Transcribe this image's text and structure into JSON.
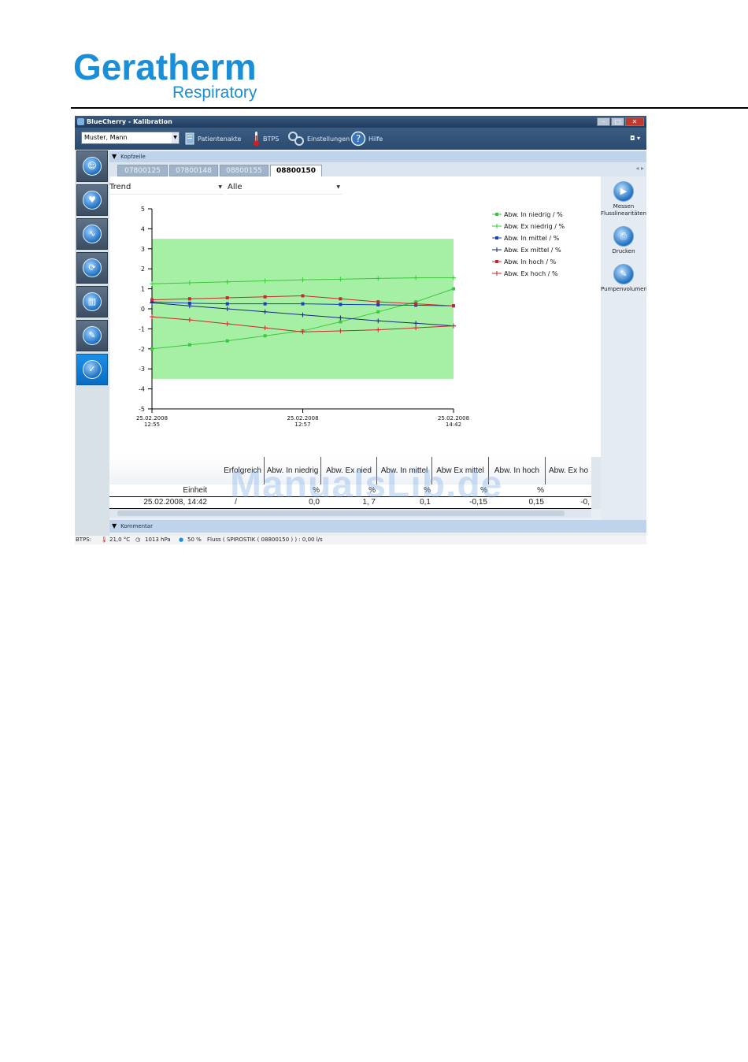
{
  "logo": {
    "brand": "Geratherm",
    "sub": "Respiratory"
  },
  "window": {
    "title": "BlueCherry - Kalibration",
    "controls": [
      "–",
      "□",
      "✕"
    ]
  },
  "toolbar": {
    "patient": "Muster, Mann",
    "patient_file": "Patientenakte",
    "btps": "BTPS",
    "settings": "Einstellungen",
    "help": "Hilfe"
  },
  "header_section": "Kopfzeile",
  "tabs": [
    {
      "label": "07800125"
    },
    {
      "label": "07800148"
    },
    {
      "label": "08800155"
    },
    {
      "label": "08800150",
      "active": true
    }
  ],
  "selectors": {
    "view": "Trend",
    "filter": "Alle"
  },
  "right_panel": [
    {
      "label_line1": "Messen",
      "label_line2": "Flusslinearitäten"
    },
    {
      "label_line1": "Drucken",
      "label_line2": ""
    },
    {
      "label_line1": "Pumpenvolumen",
      "label_line2": ""
    }
  ],
  "chart_data": {
    "type": "line",
    "x_ticks": [
      {
        "date": "25.02.2008",
        "time": "12:55"
      },
      {
        "date": "25.02.2008",
        "time": "12:57"
      },
      {
        "date": "25.02.2008",
        "time": "14:42"
      }
    ],
    "ylim": [
      -5,
      5
    ],
    "y_ticks": [
      5,
      4,
      3,
      2,
      1,
      0,
      -1,
      -2,
      -3,
      -4,
      -5
    ],
    "tolerance_band": [
      -3.5,
      3.5
    ],
    "legend_position": "top-right",
    "series": [
      {
        "name": "Abw. In niedrig / %",
        "color": "#3cc83c",
        "marker": "square",
        "values": [
          -2.0,
          -1.8,
          -1.6,
          -1.35,
          -1.1,
          -0.65,
          -0.15,
          0.35,
          1.0
        ]
      },
      {
        "name": "Abw. Ex niedrig / %",
        "color": "#3cc83c",
        "marker": "plus",
        "values": [
          1.25,
          1.3,
          1.35,
          1.4,
          1.45,
          1.48,
          1.52,
          1.55,
          1.55
        ]
      },
      {
        "name": "Abw. In mittel / %",
        "color": "#1a3cc8",
        "marker": "square",
        "values": [
          0.35,
          0.28,
          0.25,
          0.25,
          0.25,
          0.22,
          0.2,
          0.18,
          0.15
        ]
      },
      {
        "name": "Abw. Ex mittel / %",
        "color": "#1a2a7a",
        "marker": "plus",
        "values": [
          0.3,
          0.15,
          0.0,
          -0.15,
          -0.3,
          -0.45,
          -0.6,
          -0.72,
          -0.85
        ]
      },
      {
        "name": "Abw. In hoch / %",
        "color": "#c82828",
        "marker": "square",
        "values": [
          0.45,
          0.5,
          0.55,
          0.6,
          0.65,
          0.5,
          0.35,
          0.25,
          0.15
        ]
      },
      {
        "name": "Abw. Ex hoch / %",
        "color": "#c82828",
        "marker": "plus",
        "values": [
          -0.4,
          -0.55,
          -0.75,
          -0.95,
          -1.15,
          -1.1,
          -1.05,
          -0.95,
          -0.85
        ]
      }
    ]
  },
  "table": {
    "headers": [
      "Erfolgreich",
      "Abw. In niedrig",
      "Abw. Ex nied",
      "Abw. In mittel",
      "Abw Ex mittel",
      "Abw. In hoch",
      "Abw. Ex ho"
    ],
    "unit_label": "Einheit",
    "units": [
      "",
      "%",
      "%",
      "%",
      "%",
      "%",
      ""
    ],
    "row_date": "25.02.2008, 14:42",
    "row_values": [
      "/",
      "0,0",
      "1, 7",
      "0,1",
      "-0,15",
      "0,15",
      "-0,"
    ]
  },
  "comment_section": "Kommentar",
  "status": {
    "btps_label": "BTPS:",
    "temperature": "21,0 °C",
    "pressure": "1013 hPa",
    "humidity": "50 %",
    "flow": "Fluss ( SPIROSTIK ( 08800150 ) ) :  0,00 l/s"
  },
  "watermark": "ManualsLib.de"
}
